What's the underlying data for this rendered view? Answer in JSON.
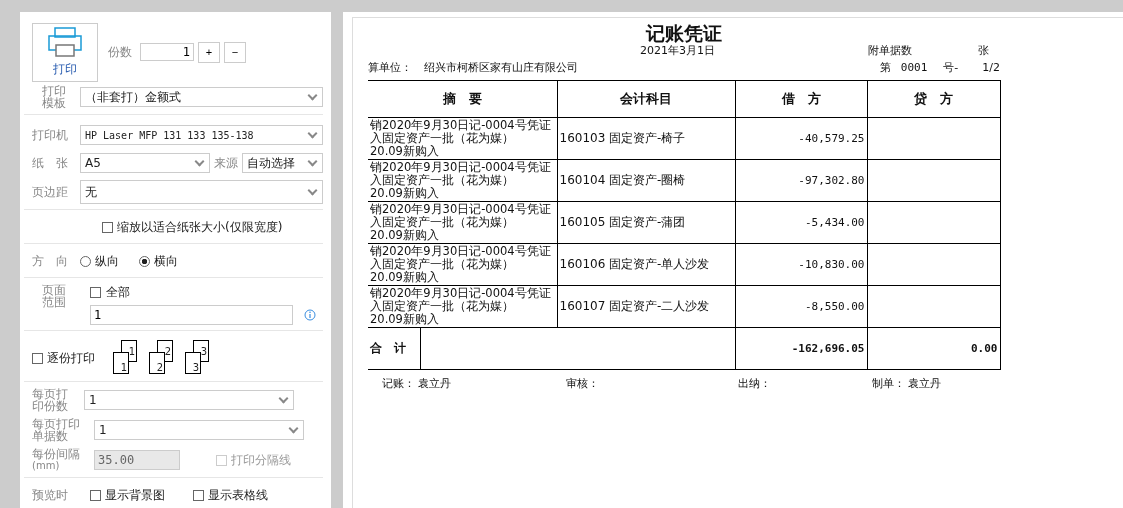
{
  "print_button": {
    "label": "打印"
  },
  "copies": {
    "label": "份数",
    "value": "1",
    "plus": "+",
    "minus": "−"
  },
  "template": {
    "label": "打印模板",
    "value": "（非套打）金额式"
  },
  "printer": {
    "label": "打印机",
    "value": "HP Laser MFP 131 133 135-138"
  },
  "paper": {
    "label": "纸　张",
    "value": "A5",
    "source_label": "来源",
    "source_value": "自动选择"
  },
  "margin": {
    "label": "页边距",
    "value": "无"
  },
  "fit_width": {
    "label": "缩放以适合纸张大小(仅限宽度)",
    "checked": false
  },
  "orientation": {
    "label": "方　向",
    "options": [
      {
        "label": "纵向",
        "selected": false
      },
      {
        "label": "横向",
        "selected": true
      }
    ]
  },
  "page_range": {
    "label": "页面范围",
    "all_label": "全部",
    "all_checked": false,
    "value": "1"
  },
  "collate": {
    "label": "逐份打印",
    "checked": false,
    "icons": [
      {
        "back": "1",
        "front": "1"
      },
      {
        "back": "2",
        "front": "2"
      },
      {
        "back": "3",
        "front": "3"
      }
    ]
  },
  "copies_per_page": {
    "label": "每页打印份数",
    "value": "1"
  },
  "docs_per_page": {
    "label": "每页打印单据数",
    "value": "1"
  },
  "spacing": {
    "label": "每份间隔",
    "unit": "(mm)",
    "value": "35.00",
    "disabled": true
  },
  "separator": {
    "label": "打印分隔线",
    "checked": false,
    "disabled": true
  },
  "preview": {
    "label": "预览时",
    "options": [
      {
        "label": "显示背景图",
        "checked": false
      },
      {
        "label": "显示表格线",
        "checked": false
      }
    ]
  },
  "voucher": {
    "title": "记账凭证",
    "date": "2021年3月1日",
    "attachments_label": "附单据数",
    "attachments_unit": "张",
    "unit_label": "算单位：",
    "unit_name": "绍兴市柯桥区家有山庄有限公司",
    "number_prefix": "第",
    "number": "0001",
    "number_suffix": "号-",
    "page": "1/2",
    "columns": [
      "摘　要",
      "会计科目",
      "借　方",
      "贷　方"
    ],
    "rows": [
      {
        "summary": [
          "销2020年9月30日记-0004号凭证",
          "入固定资产一批（花为媒）",
          "20.09新购入"
        ],
        "account": "160103 固定资产-椅子",
        "debit": "-40,579.25"
      },
      {
        "summary": [
          "销2020年9月30日记-0004号凭证",
          "入固定资产一批（花为媒）",
          "20.09新购入"
        ],
        "account": "160104 固定资产-圈椅",
        "debit": "-97,302.80"
      },
      {
        "summary": [
          "销2020年9月30日记-0004号凭证",
          "入固定资产一批（花为媒）",
          "20.09新购入"
        ],
        "account": "160105 固定资产-蒲团",
        "debit": "-5,434.00"
      },
      {
        "summary": [
          "销2020年9月30日记-0004号凭证",
          "入固定资产一批（花为媒）",
          "20.09新购入"
        ],
        "account": "160106 固定资产-单人沙发",
        "debit": "-10,830.00"
      },
      {
        "summary": [
          "销2020年9月30日记-0004号凭证",
          "入固定资产一批（花为媒）",
          "20.09新购入"
        ],
        "account": "160107 固定资产-二人沙发",
        "debit": "-8,550.00"
      }
    ],
    "total": {
      "label": "合　计",
      "debit": "-162,696.05",
      "credit": "0.00"
    },
    "signatures": [
      {
        "label": "记账：",
        "name": "袁立丹"
      },
      {
        "label": "审核："
      },
      {
        "label": "出纳："
      },
      {
        "label": "制单：",
        "name": "袁立丹"
      }
    ]
  }
}
